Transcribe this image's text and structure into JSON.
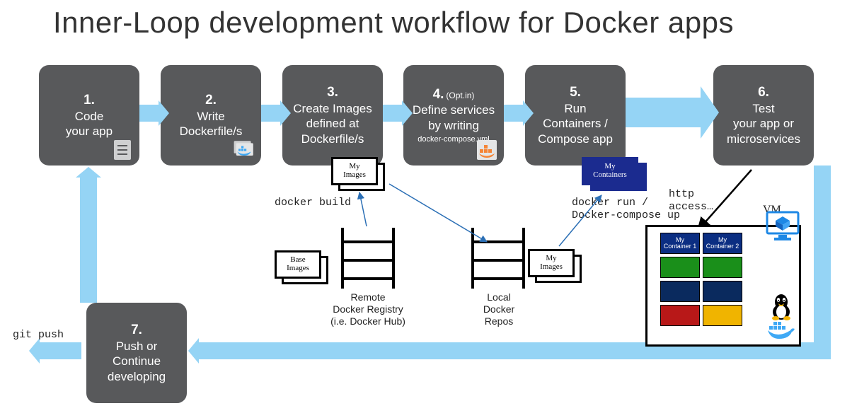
{
  "title": "Inner-Loop development workflow for Docker apps",
  "steps": {
    "s1": {
      "num": "1.",
      "line1": "Code",
      "line2": "your app"
    },
    "s2": {
      "num": "2.",
      "line1": "Write",
      "line2": "Dockerfile/s"
    },
    "s3": {
      "num": "3.",
      "line1": "Create Images",
      "line2": "defined at",
      "line3": "Dockerfile/s"
    },
    "s4": {
      "num": "4.",
      "opt": "(Opt.in)",
      "line1": "Define services",
      "line2": "by writing",
      "sub": "docker-compose.yml"
    },
    "s5": {
      "num": "5.",
      "line1": "Run",
      "line2": "Containers /",
      "line3": "Compose app"
    },
    "s6": {
      "num": "6.",
      "line1": "Test",
      "line2": "your app or",
      "line3": "microservices"
    },
    "s7": {
      "num": "7.",
      "line1": "Push or",
      "line2": "Continue",
      "line3": "developing"
    }
  },
  "labels": {
    "git_push": "git push",
    "docker_build": "docker build",
    "docker_run": "docker run /\nDocker-compose up",
    "http_access": "http\naccess…",
    "vm": "VM",
    "remote_registry": "Remote\nDocker Registry\n(i.e. Docker Hub)",
    "local_repos": "Local\nDocker\nRepos"
  },
  "cards": {
    "my_images": "My\nImages",
    "my_containers": "My\nContainers",
    "base_images": "Base\nImages"
  },
  "vm": {
    "c1": "My\nContainer 1",
    "c2": "My\nContainer 2"
  },
  "icons": {
    "document": "document-icon",
    "docker": "docker-whale-icon",
    "compose": "docker-compose-icon",
    "linux": "linux-penguin-icon",
    "monitor": "monitor-icon"
  }
}
